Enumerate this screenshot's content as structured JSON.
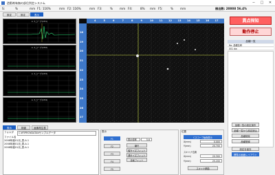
{
  "window": {
    "title": "造影剤有無の部位判定システム",
    "minimize": "─",
    "maximize": "□",
    "close": "✕"
  },
  "status": {
    "s_label": "S:",
    "s_unit": "%",
    "mm1": "mm",
    "f1": "F1: 116%",
    "mm2": "mm",
    "f2": "F2: 116%",
    "mm3": "mm",
    "f3": "F3:",
    "pct3": "%",
    "mm4": "mm",
    "f4": "F4:",
    "pct4": "8%",
    "mm5": "mm",
    "f5": "F5:",
    "pct5": "%",
    "mm6": "mm",
    "detect": "検出数: 20008 56.4%"
  },
  "top_tabs": [
    "設定",
    "設定",
    "表示"
  ],
  "waveforms": [
    {
      "label": "A スコープ(CH1)"
    },
    {
      "label": "A スコープ(CH2)"
    },
    {
      "label": "A スコープ(CH3)"
    },
    {
      "label": "A スコープ(CH4)"
    }
  ],
  "image": {
    "cols": [
      "4",
      "5",
      "6",
      "7",
      "8",
      "9",
      "10",
      "11",
      "12",
      "13",
      "14",
      "15",
      "16",
      "17",
      "18"
    ],
    "rows": [
      "18",
      "19",
      "20",
      "21",
      "22",
      "23",
      "24",
      "25",
      "26",
      "27"
    ]
  },
  "right": {
    "btn_alarm": "異点探知",
    "btn_stop": "動作停止",
    "list_header": "品種一覧",
    "list_rows": [
      "No.  品種名称",
      "001  dw"
    ],
    "side_buttons": [
      "品種一覧の設定操作",
      "品種一覧から設定読込",
      "品種削除",
      "品種登録",
      "設定を保存",
      "標準の画面レイアウト"
    ]
  },
  "bottom_tabs": [
    "表示",
    "検査",
    "画像再生表"
  ],
  "filepanel": {
    "folder_label": "フォルダ",
    "folder_value": "C:¥FIPRO¥DATA¥サンプルデータ",
    "col_header": "ファイル名",
    "files": [
      "2008年度01月_表-A.1",
      "2008年度01月_表-A.1",
      "2008年度01月_表-A.1"
    ]
  },
  "display_panel": {
    "title": "表示",
    "f_buttons": [
      "F1",
      "F2",
      "F3",
      "F4",
      "F5"
    ],
    "disp_label": "表示倍率",
    "disp_value": "5.6",
    "b_fit": "縮尺",
    "b_vfit": "縦サイズフィット",
    "b_hfit": "横サイズフィット",
    "b_full": "全画フィット"
  },
  "scan_panel": {
    "title": "位置",
    "scope_label": "Cスコープ画像表示",
    "x_label": "X(mm)",
    "x_value": "0.000",
    "y_label": "Y(mm)",
    "y_value": "20.700",
    "scan_label": "スキャナ位置",
    "sx_label": "X(mm)",
    "sx_value": "20.300",
    "sy_label": "Y(mm)",
    "sy_value": "25.200",
    "scan_button": "スキャナ移動"
  }
}
